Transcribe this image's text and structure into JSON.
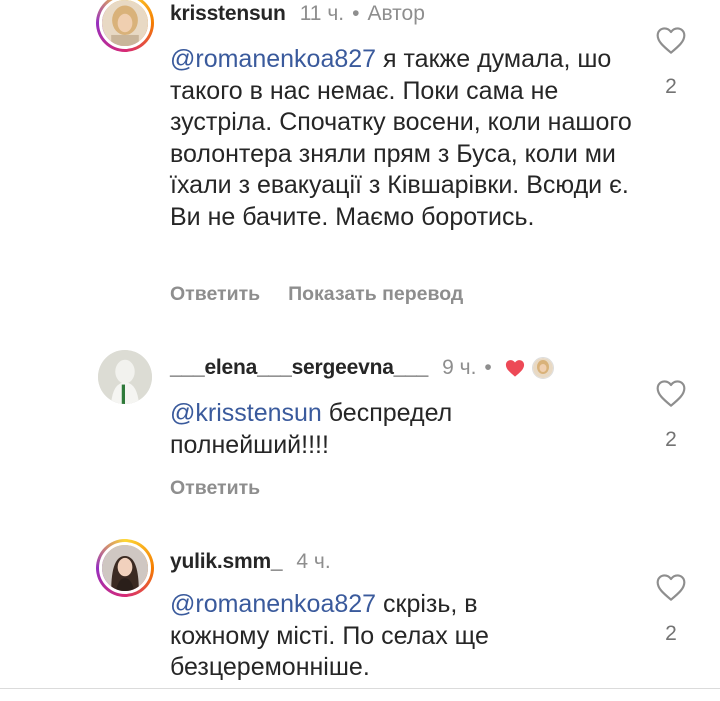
{
  "comments": [
    {
      "username": "krisstensun",
      "time": "11 ч.",
      "author_badge": "Автор",
      "mention": "@romanenkoa827",
      "text": " я также думала, шо такого в нас немає. Поки сама не зустріла. Спочатку восени, коли нашого волонтера зняли прям з Буса, коли ми їхали з евакуації з Ківшарівки. Всюди є. Ви не бачите. Маємо боротись.",
      "reply_label": "Ответить",
      "translate_label": "Показать перевод",
      "like_count": "2"
    },
    {
      "username": "___elena___sergeevna___",
      "time": "9 ч.",
      "mention": "@krisstensun",
      "text": " беспредел полнейший!!!!",
      "reply_label": "Ответить",
      "like_count": "2"
    },
    {
      "username": "yulik.smm_",
      "time": "4 ч.",
      "mention": "@romanenkoa827",
      "text": " скрізь, в кожному місті. По селах ще безцеремонніше.",
      "like_count": "2"
    }
  ],
  "colors": {
    "mention": "#3a5a9c",
    "muted": "#8e8e8e",
    "author_heart": "#ed4956"
  }
}
